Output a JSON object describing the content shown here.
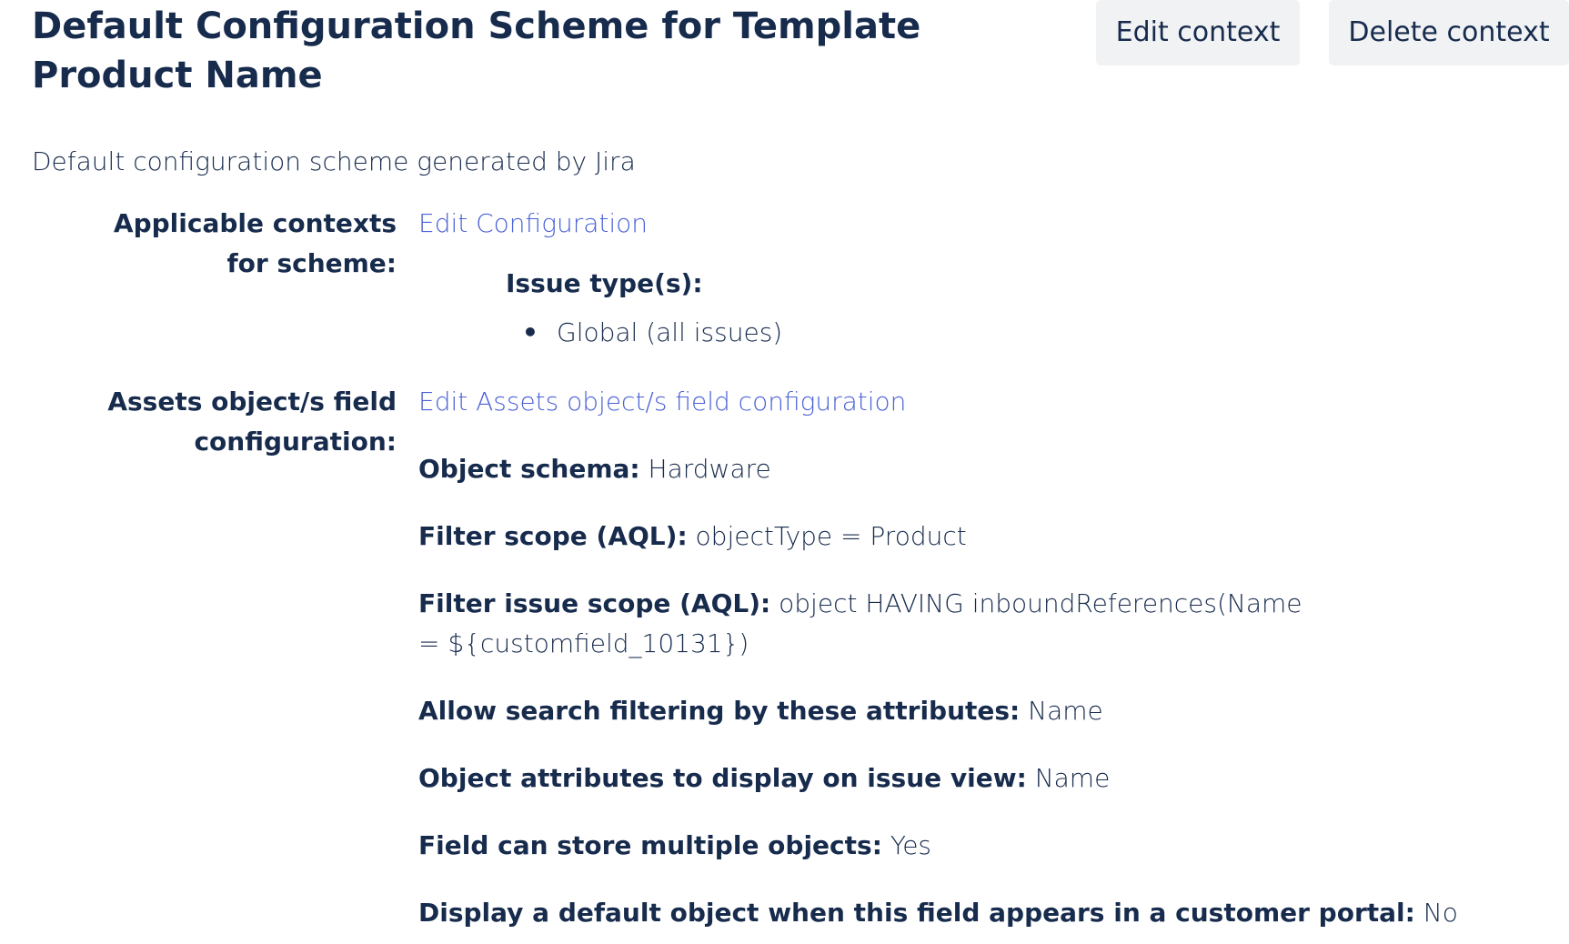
{
  "header": {
    "title": "Default Configuration Scheme for Template Product Name",
    "edit_context_label": "Edit context",
    "delete_context_label": "Delete context"
  },
  "description": "Default configuration scheme generated by Jira",
  "contexts": {
    "label": "Applicable contexts for scheme:",
    "edit_link": "Edit Configuration",
    "issue_types_heading": "Issue type(s):",
    "issue_types": [
      "Global (all issues)"
    ]
  },
  "assets": {
    "label": "Assets object/s field configuration:",
    "edit_link": "Edit Assets object/s field configuration",
    "items": [
      {
        "key": "Object schema:",
        "value": "Hardware"
      },
      {
        "key": "Filter scope (AQL):",
        "value": "objectType = Product"
      },
      {
        "key": "Filter issue scope (AQL):",
        "value": "object HAVING inboundReferences(Name = ${customfield_10131})"
      },
      {
        "key": "Allow search filtering by these attributes:",
        "value": "Name"
      },
      {
        "key": "Object attributes to display on issue view:",
        "value": "Name"
      },
      {
        "key": "Field can store multiple objects:",
        "value": "Yes"
      },
      {
        "key": "Display a default object when this field appears in a customer portal:",
        "value": "No"
      }
    ]
  }
}
